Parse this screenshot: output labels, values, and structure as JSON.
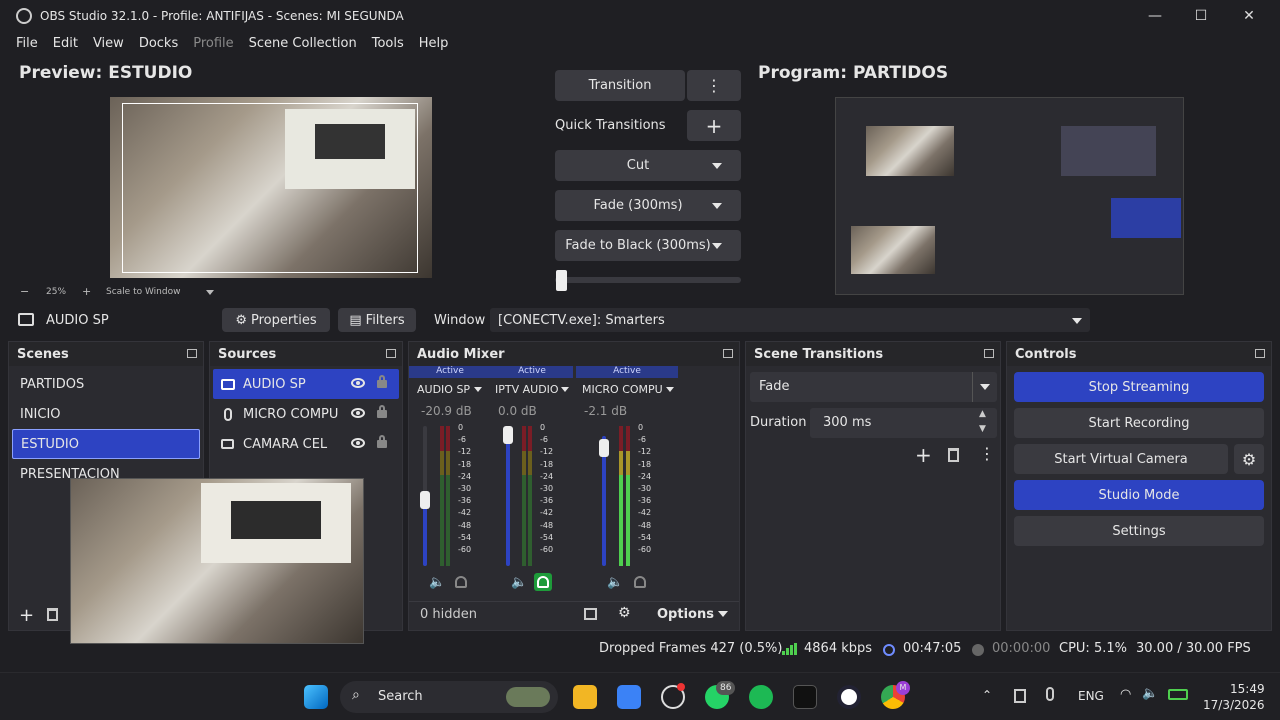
{
  "window": {
    "title": "OBS Studio 32.1.0 - Profile: ANTIFIJAS - Scenes: MI SEGUNDA",
    "minimize": "—",
    "maximize": "☐",
    "close": "✕"
  },
  "menu": [
    "File",
    "Edit",
    "View",
    "Docks",
    "Profile",
    "Scene Collection",
    "Tools",
    "Help"
  ],
  "preview": {
    "title": "Preview: ESTUDIO",
    "zoom_minus": "−",
    "zoom_level": "25%",
    "zoom_plus": "+",
    "scale_mode": "Scale to Window"
  },
  "program": {
    "title": "Program: PARTIDOS"
  },
  "transitions_center": {
    "transition_label": "Transition",
    "quick_transitions_label": "Quick Transitions",
    "add_symbol": "+",
    "more_symbol": "⋮",
    "cut": "Cut",
    "fade": "Fade (300ms)",
    "fade_black": "Fade to Black (300ms)"
  },
  "source_toolbar": {
    "selected_source": "AUDIO SP",
    "properties": "Properties",
    "filters": "Filters",
    "window_label": "Window",
    "window_value": "[CONECTV.exe]: Smarters"
  },
  "scenes": {
    "title": "Scenes",
    "items": [
      "PARTIDOS",
      "INICIO",
      "ESTUDIO",
      "PRESENTACION"
    ],
    "selected_index": 2
  },
  "sources": {
    "title": "Sources",
    "items": [
      "AUDIO SP",
      "MICRO COMPU",
      "CAMARA CEL"
    ]
  },
  "audio_mixer": {
    "title": "Audio Mixer",
    "ticks": [
      "0",
      "-6",
      "-12",
      "-18",
      "-24",
      "-30",
      "-36",
      "-42",
      "-48",
      "-54",
      "-60"
    ],
    "channels": [
      {
        "status": "Active",
        "name": "AUDIO SP",
        "db": "-20.9 dB"
      },
      {
        "status": "Active",
        "name": "IPTV AUDIO",
        "db": "0.0 dB"
      },
      {
        "status": "Active",
        "name": "MICRO COMPU",
        "db": "-2.1 dB"
      }
    ],
    "hidden": "0 hidden",
    "options": "Options"
  },
  "scene_transitions": {
    "title": "Scene Transitions",
    "selected": "Fade",
    "duration_label": "Duration",
    "duration_value": "300 ms"
  },
  "controls": {
    "title": "Controls",
    "stop_streaming": "Stop Streaming",
    "start_recording": "Start Recording",
    "start_virtual_camera": "Start Virtual Camera",
    "studio_mode": "Studio Mode",
    "settings": "Settings"
  },
  "status": {
    "dropped_frames": "Dropped Frames 427 (0.5%)",
    "bitrate": "4864 kbps",
    "stream_time": "00:47:05",
    "record_time": "00:00:00",
    "cpu": "CPU: 5.1%",
    "fps": "30.00 / 30.00 FPS"
  },
  "taskbar": {
    "search": "Search",
    "whatsapp_badge": "86",
    "chrome_badge": "M",
    "lang": "ENG",
    "time": "15:49",
    "date": "17/3/2026"
  },
  "colors": {
    "accent": "#2d43c2",
    "meter_green": "#4fcf4f",
    "meter_yellow": "#d6c23a",
    "meter_red": "#c8303a"
  }
}
